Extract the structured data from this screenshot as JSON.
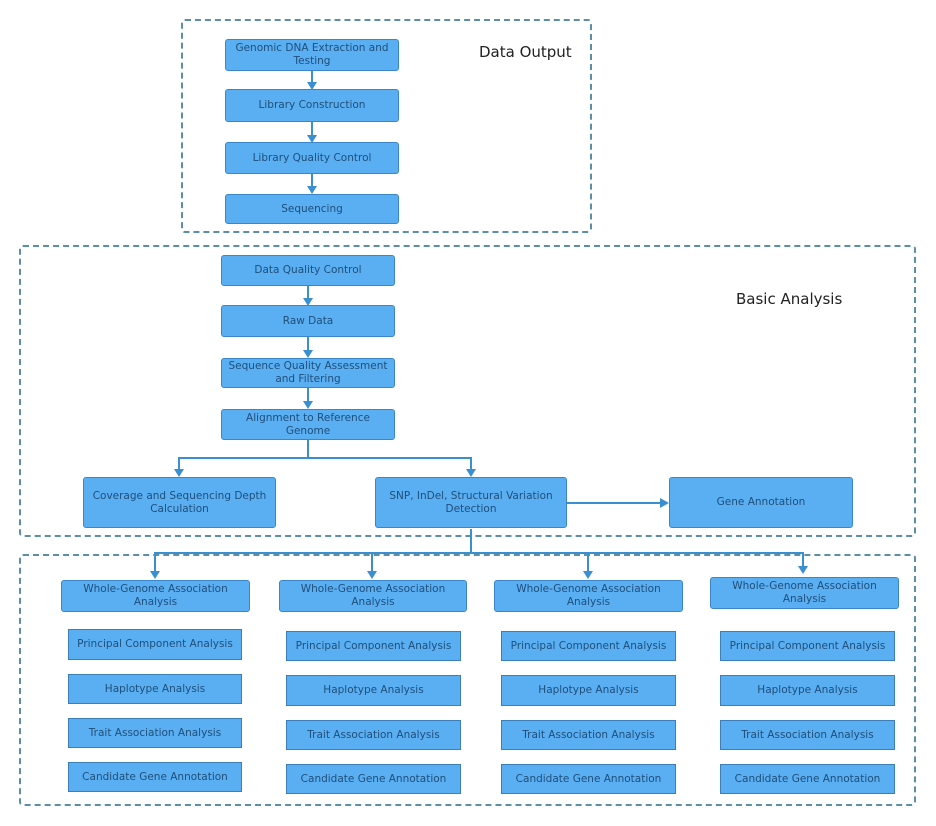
{
  "sections": {
    "data_output": {
      "title": "Data Output"
    },
    "basic_analysis": {
      "title": "Basic Analysis"
    },
    "advanced": {
      "title": ""
    }
  },
  "data_output_steps": [
    "Genomic DNA Extraction and Testing",
    "Library Construction",
    "Library Quality Control",
    "Sequencing"
  ],
  "basic_steps": [
    "Data Quality Control",
    "Raw Data",
    "Sequence Quality Assessment and Filtering",
    "Alignment to Reference Genome"
  ],
  "basic_branches": {
    "coverage": "Coverage and Sequencing Depth Calculation",
    "variation": "SNP, InDel, Structural Variation Detection",
    "gene_annotation": "Gene Annotation"
  },
  "columns": [
    {
      "header": "Whole-Genome Association Analysis",
      "items": [
        "Principal Component Analysis",
        "Haplotype Analysis",
        "Trait Association Analysis",
        "Candidate Gene Annotation"
      ]
    },
    {
      "header": "Whole-Genome Association Analysis",
      "items": [
        "Principal Component Analysis",
        "Haplotype Analysis",
        "Trait Association Analysis",
        "Candidate Gene Annotation"
      ]
    },
    {
      "header": "Whole-Genome Association Analysis",
      "items": [
        "Principal Component Analysis",
        "Haplotype Analysis",
        "Trait Association Analysis",
        "Candidate Gene Annotation"
      ]
    },
    {
      "header": "Whole-Genome Association Analysis",
      "items": [
        "Principal Component Analysis",
        "Haplotype Analysis",
        "Trait Association Analysis",
        "Candidate Gene Annotation"
      ]
    }
  ],
  "colors": {
    "node_fill": "#5aaef2",
    "node_border": "#3a86c8",
    "arrow": "#3a8fd0",
    "text": "#1f4f7a",
    "dash": "#5b8fa8"
  }
}
